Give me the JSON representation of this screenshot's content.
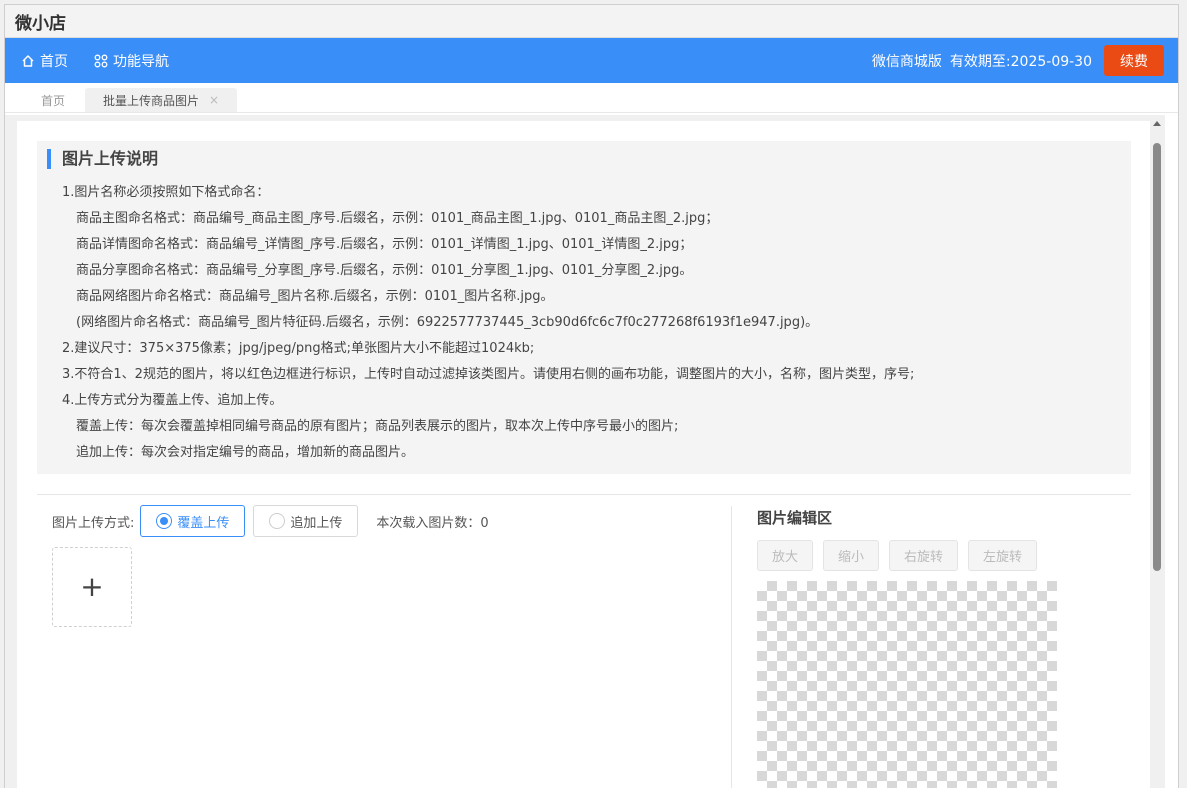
{
  "app": {
    "title": "微小店"
  },
  "navbar": {
    "items": [
      {
        "label": "首页",
        "icon": "home-icon"
      },
      {
        "label": "功能导航",
        "icon": "apps-icon"
      }
    ],
    "store_type": "微信商城版",
    "expiry": "有效期至:2025-09-30",
    "renew_label": "续费",
    "colors": {
      "bar": "#3a8ef8",
      "renew": "#ea4a13"
    }
  },
  "tabs": [
    {
      "label": "首页"
    },
    {
      "label": "批量上传商品图片",
      "close": "×"
    }
  ],
  "instructions": {
    "title": "图片上传说明",
    "lines": [
      "1.图片名称必须按照如下格式命名：",
      "商品主图命名格式：商品编号_商品主图_序号.后缀名，示例：0101_商品主图_1.jpg、0101_商品主图_2.jpg；",
      "商品详情图命名格式：商品编号_详情图_序号.后缀名，示例：0101_详情图_1.jpg、0101_详情图_2.jpg；",
      "商品分享图命名格式：商品编号_分享图_序号.后缀名，示例：0101_分享图_1.jpg、0101_分享图_2.jpg。",
      "商品网络图片命名格式：商品编号_图片名称.后缀名，示例：0101_图片名称.jpg。",
      "(网络图片命名格式：商品编号_图片特征码.后缀名，示例：6922577737445_3cb90d6fc6c7f0c277268f6193f1e947.jpg)。",
      "2.建议尺寸：375×375像素；jpg/jpeg/png格式;单张图片大小不能超过1024kb;",
      "3.不符合1、2规范的图片，将以红色边框进行标识，上传时自动过滤掉该类图片。请使用右侧的画布功能，调整图片的大小，名称，图片类型，序号;",
      "4.上传方式分为覆盖上传、追加上传。",
      "覆盖上传：每次会覆盖掉相同编号商品的原有图片；商品列表展示的图片，取本次上传中序号最小的图片;",
      "追加上传：每次会对指定编号的商品，增加新的商品图片。"
    ]
  },
  "upload": {
    "mode_label": "图片上传方式:",
    "options": [
      "覆盖上传",
      "追加上传"
    ],
    "selected": "覆盖上传",
    "count_label": "本次载入图片数：0",
    "add_symbol": "+"
  },
  "editor": {
    "title": "图片编辑区",
    "buttons": [
      "放大",
      "缩小",
      "右旋转",
      "左旋转"
    ]
  }
}
